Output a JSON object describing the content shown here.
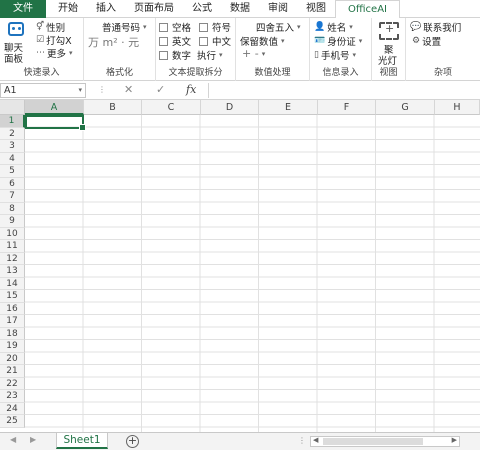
{
  "menu": {
    "file": "文件",
    "tabs": [
      "开始",
      "插入",
      "页面布局",
      "公式",
      "数据",
      "审阅",
      "视图"
    ],
    "active_tab": "OfficeAI"
  },
  "ribbon": {
    "quick_entry": {
      "chat_label_1": "聊天",
      "chat_label_2": "面板",
      "gender": "性别",
      "check": "打勾X",
      "more": "更多",
      "label": "快速录入"
    },
    "format": {
      "number_code": "普通号码",
      "symbols": "万  m²  ·  元",
      "label": "格式化"
    },
    "text_split": {
      "space": "空格",
      "symbol": "符号",
      "english": "英文",
      "chinese": "中文",
      "digits": "数字",
      "execute": "执行",
      "label": "文本提取拆分"
    },
    "numeric": {
      "round": "四舍五入",
      "keep": "保留数值",
      "plusminus": "+ -",
      "label": "数值处理"
    },
    "info_entry": {
      "name": "姓名",
      "id_card": "身份证",
      "phone": "手机号",
      "label": "信息录入"
    },
    "view": {
      "spotlight_1": "聚",
      "spotlight_2": "光灯",
      "label": "视图"
    },
    "misc": {
      "contact": "联系我们",
      "settings": "设置",
      "label": "杂项"
    }
  },
  "formula_bar": {
    "cell_ref": "A1",
    "fx": "fx",
    "value": ""
  },
  "grid": {
    "columns": [
      "A",
      "B",
      "C",
      "D",
      "E",
      "F",
      "G",
      "H"
    ],
    "rows": [
      "1",
      "2",
      "3",
      "4",
      "5",
      "6",
      "7",
      "8",
      "9",
      "10",
      "11",
      "12",
      "13",
      "14",
      "15",
      "16",
      "17",
      "18",
      "19",
      "20",
      "21",
      "22",
      "23",
      "24",
      "25"
    ]
  },
  "sheets": {
    "tabs": [
      "Sheet1"
    ],
    "add": "+"
  }
}
